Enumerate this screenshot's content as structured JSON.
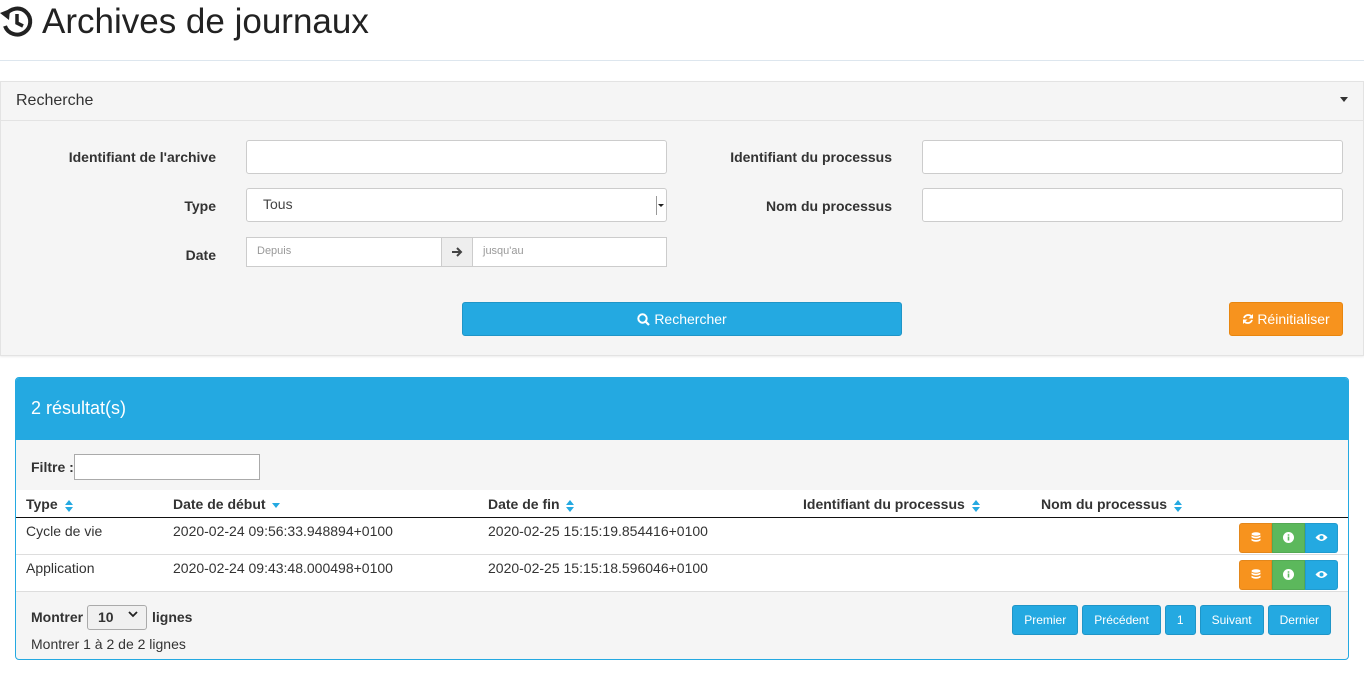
{
  "page": {
    "title": "Archives de journaux"
  },
  "search": {
    "title": "Recherche",
    "archive_id": {
      "label": "Identifiant de l'archive",
      "value": ""
    },
    "process_id": {
      "label": "Identifiant du processus",
      "value": ""
    },
    "type": {
      "label": "Type",
      "value": "Tous"
    },
    "process_name": {
      "label": "Nom du processus",
      "value": ""
    },
    "date": {
      "label": "Date",
      "from_placeholder": "Depuis",
      "to_placeholder": "jusqu'au"
    },
    "search_button": "Rechercher",
    "reset_button": "Réinitialiser"
  },
  "results": {
    "title": "2 résultat(s)",
    "filter_label": "Filtre :",
    "columns": [
      "Type",
      "Date de début",
      "Date de fin",
      "Identifiant du processus",
      "Nom du processus"
    ],
    "rows": [
      {
        "type": "Cycle de vie",
        "start": "2020-02-24 09:56:33.948894+0100",
        "end": "2020-02-25 15:15:19.854416+0100",
        "process_id": "",
        "process_name": ""
      },
      {
        "type": "Application",
        "start": "2020-02-24 09:43:48.000498+0100",
        "end": "2020-02-25 15:15:18.596046+0100",
        "process_id": "",
        "process_name": ""
      }
    ],
    "show_label": "Montrer",
    "page_size": "10",
    "lines_label": "lignes",
    "info": "Montrer 1 à 2 de 2 lignes",
    "pagination": {
      "first": "Premier",
      "previous": "Précédent",
      "page": "1",
      "next": "Suivant",
      "last": "Dernier"
    }
  },
  "colors": {
    "primary": "#24a9e1",
    "warning": "#f7931e",
    "success": "#5cb85c"
  },
  "icons": {
    "header": "history-icon",
    "search_button": "search-icon",
    "reset_button": "refresh-icon",
    "date_separator": "arrow-right-icon",
    "row_actions": [
      "database-icon",
      "info-icon",
      "eye-icon"
    ]
  }
}
